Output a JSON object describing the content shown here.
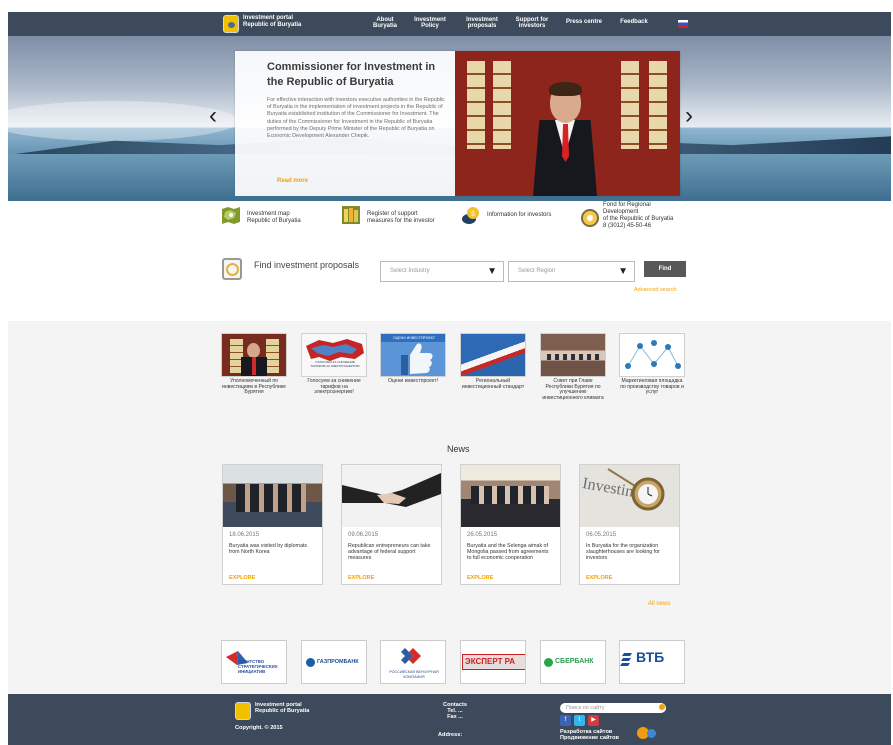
{
  "header": {
    "brand_line1": "Investment portal",
    "brand_line2": "Republic of Buryatia",
    "nav": [
      {
        "line1": "About",
        "line2": "Buryatia"
      },
      {
        "line1": "Investment",
        "line2": "Policy"
      },
      {
        "line1": "Investment",
        "line2": "proposals"
      },
      {
        "line1": "Support for",
        "line2": "investors"
      },
      {
        "line1": "Press centre",
        "line2": ""
      },
      {
        "line1": "Feedback",
        "line2": ""
      }
    ]
  },
  "slider": {
    "title": "Commissioner for Investment in the Republic of Buryatia",
    "text": "For effective interaction with investors executive authorities in the Republic of Buryatia in the implementation of investment projects in the Republic of Buryatia established institution of the Commissioner for Investment. The duties of the Commissioner for Investment in the Republic of Buryatia performed by the Deputy Prime Minister of the Republic of Buryatia on Economic Development Alexander Chepik.",
    "more": "Read more",
    "prev": "‹",
    "next": "›"
  },
  "quick_links": [
    {
      "line1": "Investment map",
      "line2": "Republic of Buryatia",
      "line3": "",
      "line4": ""
    },
    {
      "line1": "Register of support",
      "line2": "measures for the investor",
      "line3": "",
      "line4": ""
    },
    {
      "line1": "Information for investors",
      "line2": "",
      "line3": "",
      "line4": ""
    },
    {
      "line1": "Fond for Regional",
      "line2": "Development",
      "line3": "of the Republic of Buryatia",
      "line4": "8 (3012) 45-50-46"
    }
  ],
  "search": {
    "title": "Find investment proposals",
    "industry_placeholder": "Select Industry",
    "region_placeholder": "Select Region",
    "button": "Find",
    "advanced": "Advanced search"
  },
  "tiles": [
    {
      "caption": "Уполномоченный по инвестициям в Республике Бурятия"
    },
    {
      "caption": "Голосуем за снижение тарифов на электроэнергию!"
    },
    {
      "caption": "Оцени инвестпроект!"
    },
    {
      "caption": "Региональный инвестиционный стандарт"
    },
    {
      "caption": "Совет при Главе Республики Бурятия по улучшению инвестиционного климата"
    },
    {
      "caption": "Маркетинговая площадка по производству товаров и услуг"
    }
  ],
  "tile_texts": {
    "tile2_top": "ГОЛОСУЕМ ЗА СНИЖЕНИЕ ТАРИФОВ НА ЭЛЕКТРОЭНЕРГИЮ",
    "tile3_top": "ОЦЕНИ ИНВЕСТПРОЕКТ"
  },
  "news": {
    "title": "News",
    "items": [
      {
        "date": "18.06.2015",
        "text": "Buryatia was visited by diplomats from North Korea",
        "explore": "EXPLORE"
      },
      {
        "date": "09.06.2015",
        "text": "Republican entrepreneurs can take advantage of federal support measures",
        "explore": "EXPLORE"
      },
      {
        "date": "26.05.2015",
        "text": "Buryatia and the Selenga aimak of Mongolia passed from agreements to full economic cooperation",
        "explore": "EXPLORE"
      },
      {
        "date": "06.05.2015",
        "text": "In Buryatia for the organization slaughterhouses are looking for investors",
        "explore": "EXPLORE"
      }
    ],
    "all_news": "All news",
    "investing_word": "Investing"
  },
  "partners": [
    {
      "line1": "АГЕНТСТВО",
      "line2": "СТРАТЕГИЧЕСКИХ",
      "line3": "ИНИЦИАТИВ"
    },
    {
      "line1": "ГАЗПРОМБАНК",
      "line2": "",
      "line3": ""
    },
    {
      "line1": "РОССИЙСКАЯ ВЕНЧУРНАЯ",
      "line2": "КОМПАНИЯ",
      "line3": ""
    },
    {
      "line1": "ЭКСПЕРТ РА",
      "line2": "",
      "line3": ""
    },
    {
      "line1": "СБЕРБАНК",
      "line2": "",
      "line3": ""
    },
    {
      "line1": "ВТБ",
      "line2": "",
      "line3": ""
    }
  ],
  "footer": {
    "brand_line1": "Investment portal",
    "brand_line2": "Republic of Buryatia",
    "copyright": "Copyright. © 2015",
    "contacts": "Contacts",
    "tel": "Tel. ...",
    "fax": "Fax ...",
    "address": "Address:",
    "search_placeholder": "Поиск по сайту",
    "dev1": "Разработка сайтов",
    "dev2": "Продвижение сайтов",
    "social_f": "f",
    "social_t": "t",
    "social_y": "▶"
  },
  "colors": {
    "header": "#3c4a5b",
    "accent": "#f2a300",
    "footer": "#3c4a5b"
  }
}
